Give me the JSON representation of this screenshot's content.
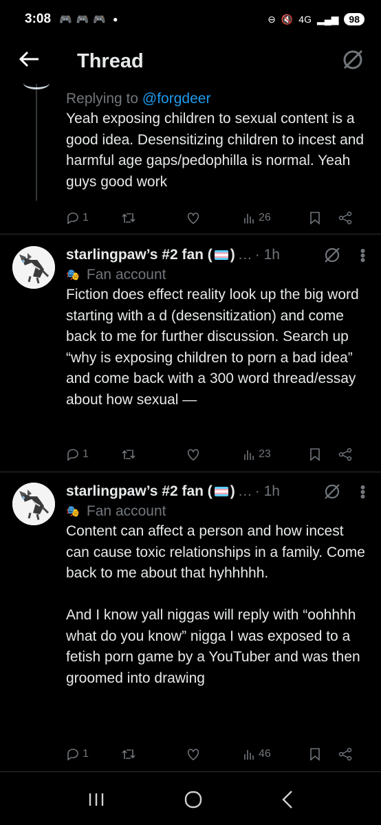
{
  "status_bar": {
    "time": "3:08",
    "network": "4G",
    "battery": "98"
  },
  "header": {
    "title": "Thread"
  },
  "tweets": [
    {
      "reply_prefix": "Replying to",
      "reply_handle": "@forgdeer",
      "text": "Yeah exposing children to sexual content is a good idea. Desensitizing children to incest and harmful age gaps/pedophilla is normal. Yeah guys good work",
      "replies": "1",
      "views": "26"
    },
    {
      "name": "starlingpaw’s #2 fan (",
      "name_end": ")",
      "ellipsis": "…",
      "time": "· 1h",
      "badge": "Fan account",
      "text": "Fiction does effect reality look up the big word starting with a d (desensitization) and come back to me for further discussion. Search up “why is exposing children to porn a bad idea” and come back with a 300 word thread/essay about how sexual —",
      "replies": "1",
      "views": "23"
    },
    {
      "name": "starlingpaw’s #2 fan (",
      "name_end": ")",
      "ellipsis": "…",
      "time": "· 1h",
      "badge": "Fan account",
      "text": "Content can affect a person and how incest can cause toxic relationships in a family. Come back to me about that hyhhhhh.\n\nAnd I know yall niggas will reply with “oohhhh what do you know” nigga I was exposed to a fetish porn game by a YouTuber and was then groomed into drawing",
      "replies": "1",
      "views": "46"
    }
  ],
  "colors": {
    "background": "#000000",
    "text": "#e7e9ea",
    "muted": "#71767b",
    "link": "#1d9bf0"
  }
}
